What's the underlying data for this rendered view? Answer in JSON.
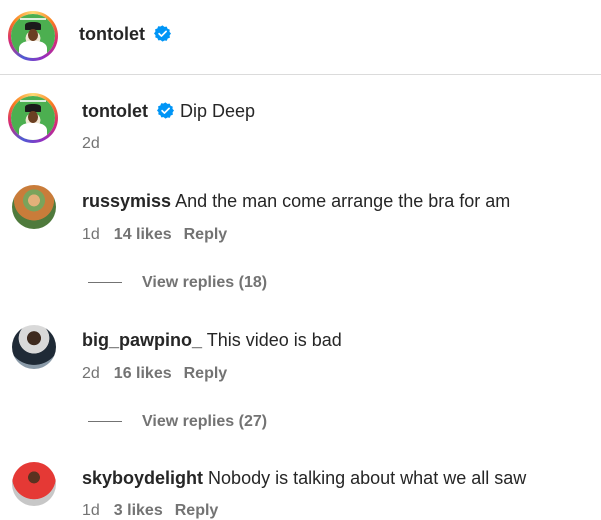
{
  "header": {
    "username": "tontolet"
  },
  "post": {
    "username": "tontolet",
    "caption": "Dip Deep",
    "time": "2d"
  },
  "comments": [
    {
      "username": "russymiss",
      "text": "And the man come arrange the bra for am",
      "time": "1d",
      "likes": "14 likes",
      "reply": "Reply",
      "view_replies": "View replies (18)"
    },
    {
      "username": "big_pawpino_",
      "text": "This video is bad",
      "time": "2d",
      "likes": "16 likes",
      "reply": "Reply",
      "view_replies": "View replies (27)"
    },
    {
      "username": "skyboydelight",
      "text": "Nobody is talking about what we all saw",
      "time": "1d",
      "likes": "3 likes",
      "reply": "Reply"
    }
  ],
  "colors": {
    "verified": "#0095f6",
    "secondary_text": "#737373",
    "primary_text": "#262626",
    "divider": "#dbdbdb"
  },
  "icons": {
    "verified": "verified-badge-icon"
  }
}
